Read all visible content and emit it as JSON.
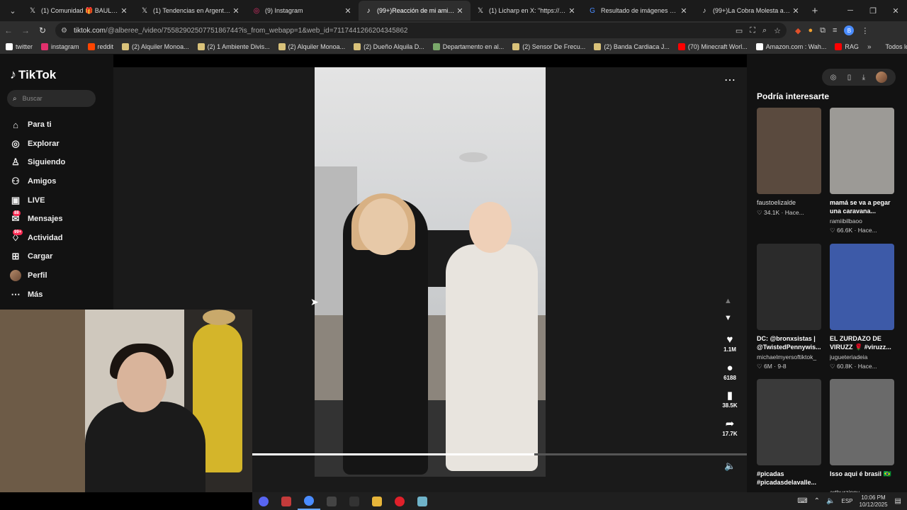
{
  "tabs": [
    {
      "title": "(1) Comunidad 🎁 BAULO CLUB",
      "icon": "x-icon",
      "active": false
    },
    {
      "title": "(1) Tendencias en Argentina en",
      "icon": "x-icon",
      "active": false
    },
    {
      "title": "(9) Instagram",
      "icon": "instagram-icon",
      "active": false
    },
    {
      "title": "(99+)Reacción de mi amigo a n",
      "icon": "tiktok-icon",
      "active": true
    },
    {
      "title": "(1) Licharp en X: \"https://t.co/Z",
      "icon": "x-icon",
      "active": false
    },
    {
      "title": "Resultado de imágenes de Goo",
      "icon": "google-icon",
      "active": false
    },
    {
      "title": "(99+)La Cobra Molesta a Davo",
      "icon": "tiktok-icon",
      "active": false
    }
  ],
  "address": {
    "url_host": "tiktok.com",
    "url_path": "/@alberee_/video/7558290250775186744?is_from_webapp=1&web_id=7117441266204345862"
  },
  "bookmarks": [
    {
      "label": "twitter",
      "color": "#ffffff"
    },
    {
      "label": "instagram",
      "color": "#e1306c"
    },
    {
      "label": "reddit",
      "color": "#ff4500"
    },
    {
      "label": "(2) Alquiler Monoa...",
      "color": "#d9c27a"
    },
    {
      "label": "(2) 1 Ambiente Divis...",
      "color": "#d9c27a"
    },
    {
      "label": "(2) Alquiler Monoa...",
      "color": "#d9c27a"
    },
    {
      "label": "(2) Dueño Alquila D...",
      "color": "#d9c27a"
    },
    {
      "label": "Departamento en al...",
      "color": "#7aa86a"
    },
    {
      "label": "(2) Sensor De Frecu...",
      "color": "#d9c27a"
    },
    {
      "label": "(2) Banda Cardiaca J...",
      "color": "#d9c27a"
    },
    {
      "label": "(70) Minecraft Worl...",
      "color": "#ff0000"
    },
    {
      "label": "Amazon.com : Wah...",
      "color": "#ffffff"
    },
    {
      "label": "RAG",
      "color": "#ff0000"
    }
  ],
  "bookmarks_more": "»",
  "bookmarks_all": "Todos los marcadores",
  "sidebar": {
    "logo": "TikTok",
    "search_placeholder": "Buscar",
    "items": [
      {
        "label": "Para ti",
        "icon": "home-icon"
      },
      {
        "label": "Explorar",
        "icon": "compass-icon"
      },
      {
        "label": "Siguiendo",
        "icon": "following-icon"
      },
      {
        "label": "Amigos",
        "icon": "friends-icon"
      },
      {
        "label": "LIVE",
        "icon": "live-icon"
      },
      {
        "label": "Mensajes",
        "icon": "messages-icon",
        "badge": "88"
      },
      {
        "label": "Actividad",
        "icon": "activity-icon",
        "badge": "99+"
      },
      {
        "label": "Cargar",
        "icon": "upload-icon"
      },
      {
        "label": "Perfil",
        "icon": "avatar"
      },
      {
        "label": "Más",
        "icon": "more-icon"
      }
    ]
  },
  "video": {
    "progress": 0.57,
    "likes": "1.1M",
    "comments": "6188",
    "saves": "38.5K",
    "shares": "17.7K"
  },
  "recommended": {
    "title": "Podría interesarte",
    "cards": [
      {
        "title": "faustoelizalde",
        "author": "",
        "meta": "♡ 34.1K · Hace...",
        "thumb": "#5a4a3e",
        "single": true
      },
      {
        "title": "mamá se va a pegar una caravana...",
        "author": "ramiibilbaoo",
        "meta": "♡ 66.6K · Hace...",
        "thumb": "#9c9a96",
        "single": false
      },
      {
        "title": "DC: @bronxsistas | @TwistedPennywis...",
        "author": "michaelmyersoftiktok_",
        "meta": "♡ 6M · 9-8",
        "thumb": "#2b2b2b",
        "single": false
      },
      {
        "title": "EL ZURDAZO DE VIRUZZ 🌹 #viruzz...",
        "author": "jugueteriadeia",
        "meta": "♡ 60.8K · Hace...",
        "thumb": "#3d5aa8",
        "single": false
      },
      {
        "title": "#picadas #picadasdelavalle...",
        "author": "",
        "meta": "",
        "thumb": "#3a3a3a",
        "single": false
      },
      {
        "title": "Isso aqui é brasil 🇧🇷",
        "author": "arthurzinnv",
        "meta": "",
        "thumb": "#6a6a6a",
        "single": false
      }
    ]
  },
  "taskbar": {
    "apps": [
      {
        "name": "discord-icon",
        "color": "#5865f2"
      },
      {
        "name": "app-icon",
        "color": "#c43b3b"
      },
      {
        "name": "chrome-icon",
        "color": "#4a8cff"
      },
      {
        "name": "obs-icon",
        "color": "#444444"
      },
      {
        "name": "app2-icon",
        "color": "#333333"
      },
      {
        "name": "folder-icon",
        "color": "#e7b53a"
      },
      {
        "name": "opera-icon",
        "color": "#e0202a"
      },
      {
        "name": "notepad-icon",
        "color": "#6fb3c9"
      }
    ],
    "lang": "ESP",
    "time": "10:06 PM",
    "date": "10/12/2025"
  }
}
